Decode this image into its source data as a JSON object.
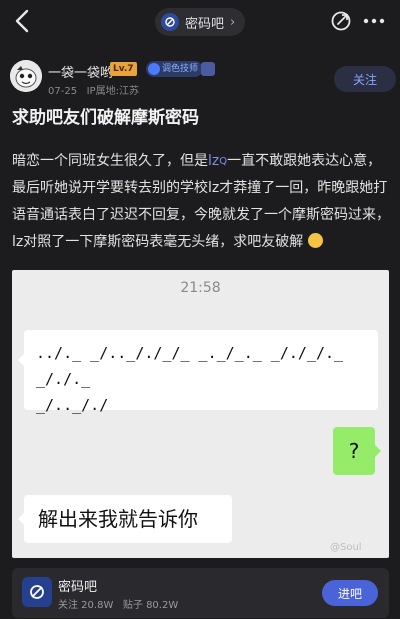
{
  "topbar": {
    "forum_name": "密码吧",
    "chevron": "›"
  },
  "author": {
    "name": "一袋一袋哟",
    "level": "Lv.7",
    "badge": "调色技师",
    "date": "07-25",
    "ip": "IP属地:江苏",
    "follow_label": "关注"
  },
  "post": {
    "title": "求助吧友们破解摩斯密码",
    "text_1": "暗恋一个同班女生很久了，但是",
    "lz_1": "lz",
    "search_mark": "Q",
    "text_2": "一直不敢跟她表达心意，最后听她说开学要转去别的学校lz才莽撞了一回，昨晚跟她打语音通话表白了迟迟不回复，今晚就发了一个摩斯密码过来，lz对照了一下摩斯密码表毫无头绪，求吧友破解"
  },
  "chat": {
    "time": "21:58",
    "morse_line_1": "../._ _/.._/./_/_ _._/_._ _/./_/._ _/./._",
    "morse_line_2": "_/.._/./",
    "question": "?",
    "answer": "解出来我就告诉你",
    "watermark": "@Soul"
  },
  "forum_card": {
    "name": "密码吧",
    "follow_count": "关注 20.8W",
    "post_count": "贴子 80.2W",
    "enter_label": "进吧"
  },
  "icons": {
    "back": "back-arrow-icon",
    "share": "share-icon",
    "more": "more-icon"
  },
  "colors": {
    "background": "#1c1c1e",
    "accent": "#4a63d8",
    "link": "#7d8fe8",
    "chat_green": "#95ec69"
  }
}
